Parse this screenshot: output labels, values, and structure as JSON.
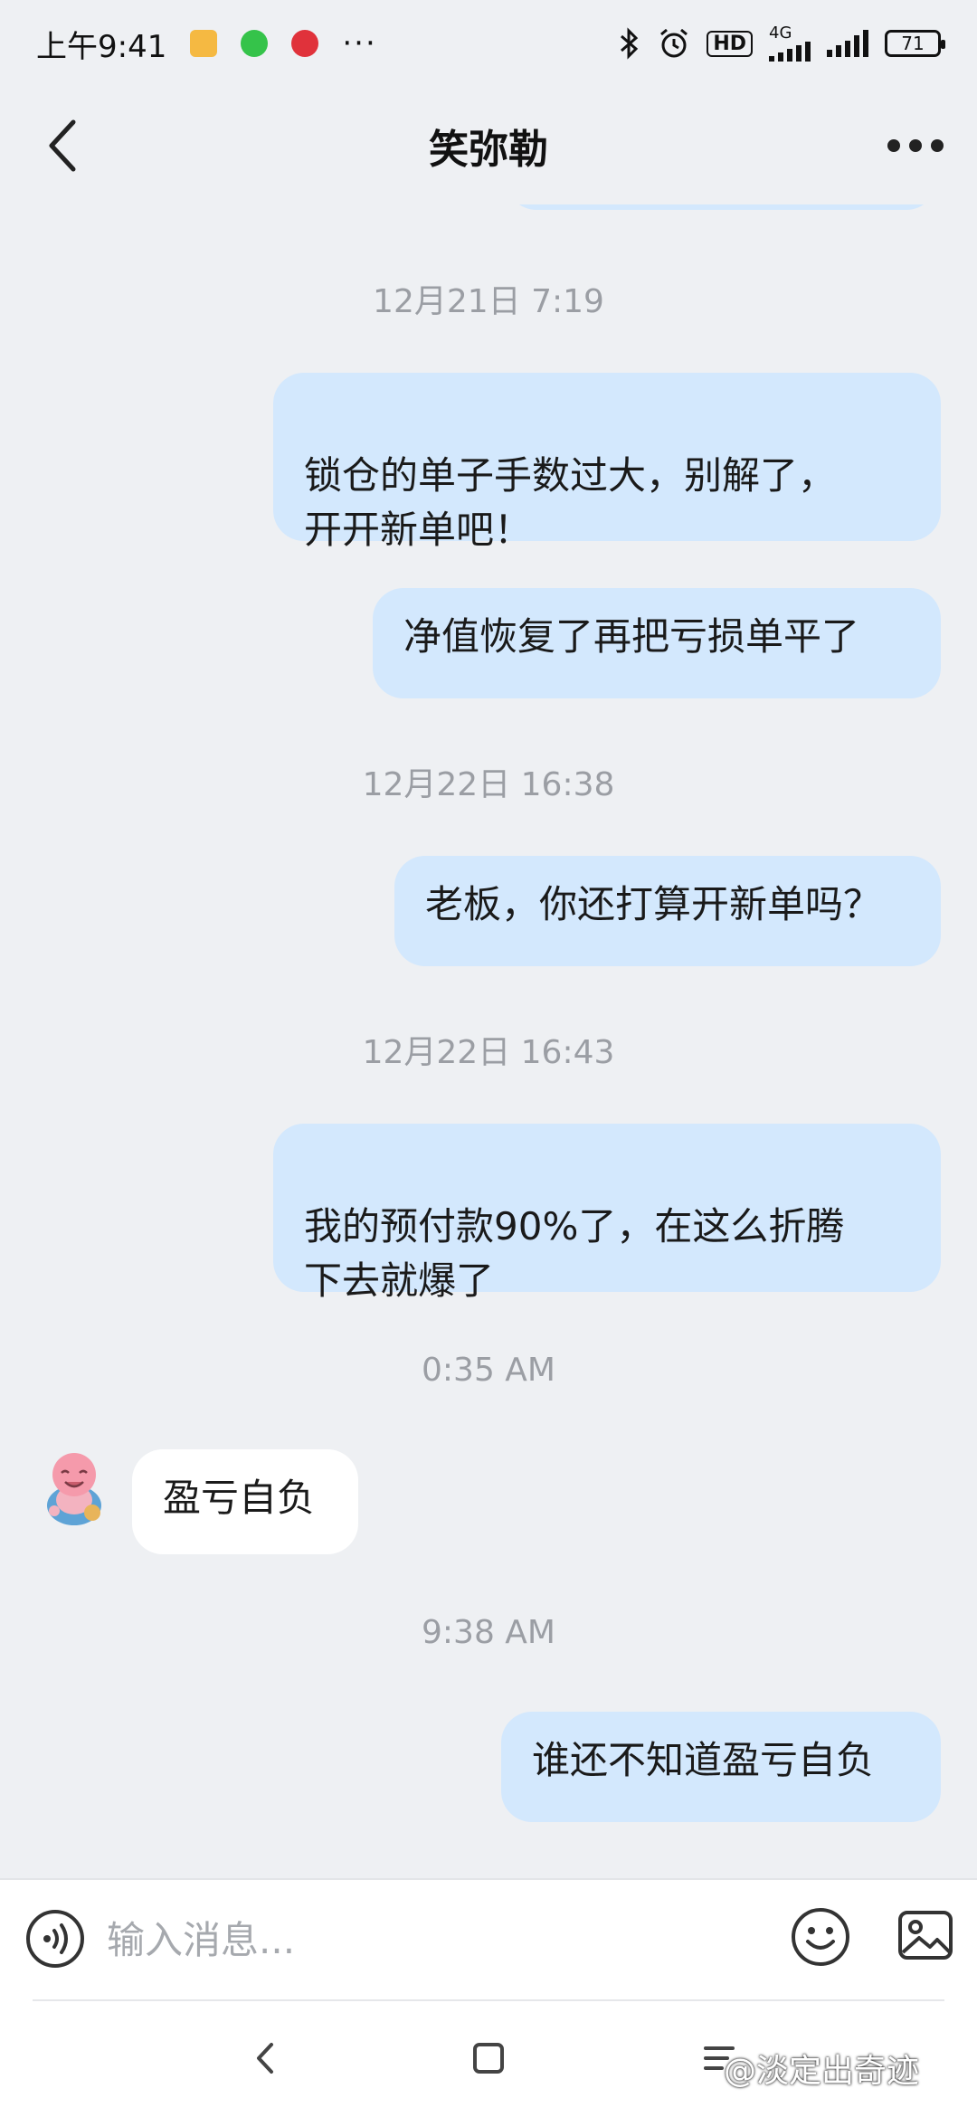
{
  "status_bar": {
    "time": "上午9:41",
    "more": "···",
    "hd": "HD",
    "network": "4G",
    "battery": "71"
  },
  "header": {
    "title": "笑弥勒"
  },
  "messages": [
    {
      "kind": "time",
      "text": "12月21日 7:19"
    },
    {
      "kind": "sent",
      "text": "锁仓的单子手数过大，别解了，\n开开新单吧！"
    },
    {
      "kind": "sent",
      "text": "净值恢复了再把亏损单平了"
    },
    {
      "kind": "time",
      "text": "12月22日 16:38"
    },
    {
      "kind": "sent",
      "text": "老板，你还打算开新单吗？"
    },
    {
      "kind": "time",
      "text": "12月22日 16:43"
    },
    {
      "kind": "sent",
      "text": "我的预付款90%了，在这么折腾\n下去就爆了"
    },
    {
      "kind": "time",
      "text": "0:35 AM"
    },
    {
      "kind": "received",
      "text": "盈亏自负"
    },
    {
      "kind": "time",
      "text": "9:38 AM"
    },
    {
      "kind": "sent",
      "text": "谁还不知道盈亏自负"
    }
  ],
  "input": {
    "placeholder": "输入消息..."
  },
  "watermark": "@淡定出奇迹",
  "colors": {
    "background": "#eef0f3",
    "sent_bubble": "#d3e8fd",
    "received_bubble": "#ffffff",
    "timestamp": "#9b9ea4"
  }
}
